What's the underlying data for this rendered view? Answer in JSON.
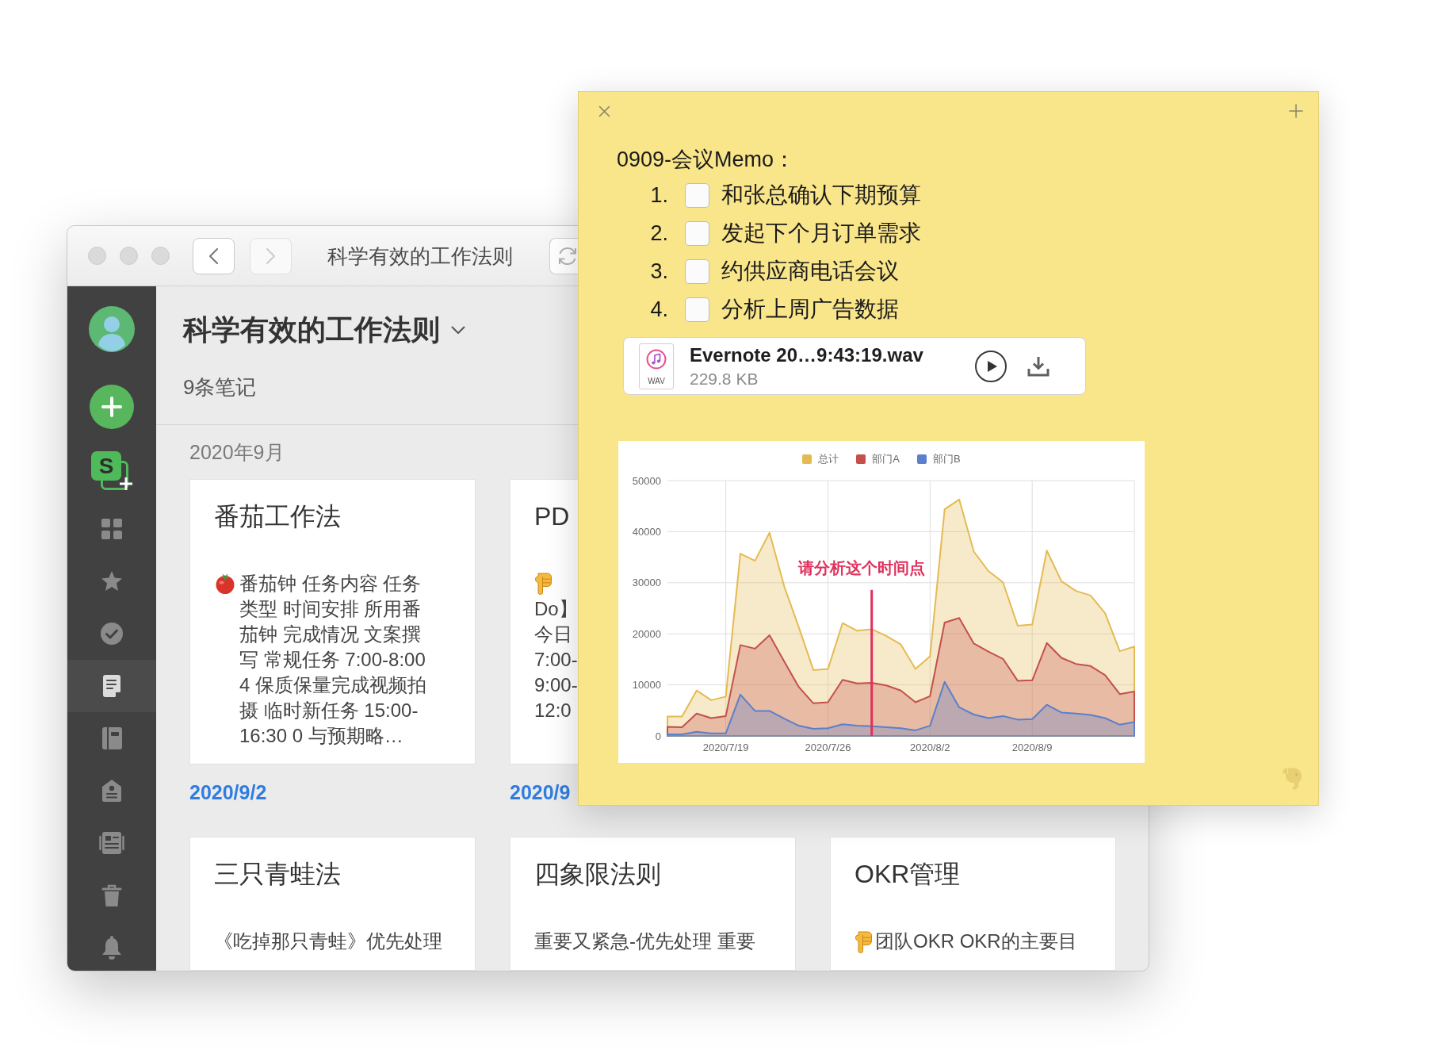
{
  "main_window": {
    "title": "科学有效的工作法则",
    "nav_buttons": [
      {
        "kind": "back",
        "disabled": false
      },
      {
        "kind": "forward",
        "disabled": true
      }
    ]
  },
  "sidebar": {
    "space_button": "S",
    "nav": [
      {
        "kind": "grid",
        "selected": false
      },
      {
        "kind": "star",
        "selected": false
      },
      {
        "kind": "check",
        "selected": false
      },
      {
        "kind": "note",
        "selected": true
      },
      {
        "kind": "notebook",
        "selected": false
      },
      {
        "kind": "tag",
        "selected": false
      },
      {
        "kind": "shared",
        "selected": false
      },
      {
        "kind": "trash",
        "selected": false
      },
      {
        "kind": "bell",
        "selected": false
      }
    ]
  },
  "notebook": {
    "title": "科学有效的工作法则",
    "note_count": "9条笔记",
    "month": "2020年9月",
    "rows": [
      {
        "notes": [
          {
            "kind": "tomato",
            "title": "番茄工作法",
            "preview": "番茄钟 任务内容 任务类型 时间安排 所用番茄钟 完成情况 文案撰写 常规任务 7:00-8:00 4 保质保量完成视频拍摄 临时新任务 15:00-16:30 0 与预期略…",
            "date": "2020/9/2"
          },
          {
            "kind": "pointing",
            "title": "PD",
            "preview": "Do】今日7:00-9:00-12:0",
            "date": "2020/9"
          }
        ]
      },
      {
        "notes": [
          {
            "kind": "plain",
            "title": "三只青蛙法",
            "preview": "《吃掉那只青蛙》优先处理"
          },
          {
            "kind": "plain",
            "title": "四象限法则",
            "preview": "重要又紧急-优先处理 重要"
          },
          {
            "kind": "pointing",
            "title": "OKR管理",
            "preview": "团队OKR OKR的主要目"
          }
        ]
      }
    ]
  },
  "sticky_note": {
    "title": "0909-会议Memo：",
    "tasks": [
      {
        "number": "1.",
        "text": "和张总确认下期预算",
        "checked": false
      },
      {
        "number": "2.",
        "text": "发起下个月订单需求",
        "checked": false
      },
      {
        "number": "3.",
        "text": "约供应商电话会议",
        "checked": false
      },
      {
        "number": "4.",
        "text": "分析上周广告数据",
        "checked": false
      }
    ],
    "attachment": {
      "file_type": "WAV",
      "name": "Evernote 20…9:43:19.wav",
      "size": "229.8 KB"
    },
    "chart": {
      "chart_data": {
        "type": "area",
        "stacked": false,
        "grid": true,
        "legend": "top",
        "categories": [
          null,
          null,
          null,
          null,
          "2020/7/19",
          null,
          null,
          null,
          null,
          null,
          null,
          "2020/7/26",
          null,
          null,
          null,
          null,
          null,
          null,
          "2020/8/2",
          null,
          null,
          null,
          null,
          null,
          null,
          "2020/8/9",
          null,
          null,
          null,
          null,
          null,
          null,
          null
        ],
        "ylim": [
          0,
          50000
        ],
        "yticks": [
          0,
          10000,
          20000,
          30000,
          40000,
          50000
        ],
        "series": [
          {
            "name": "总计",
            "color": "#e4bb52",
            "values": [
              3800,
              3800,
              8900,
              7000,
              7700,
              35700,
              34300,
              39800,
              29300,
              21300,
              12900,
              13100,
              22100,
              20600,
              20900,
              19600,
              17900,
              13100,
              15600,
              44400,
              46300,
              36100,
              32300,
              30100,
              21600,
              21800,
              36300,
              30300,
              28400,
              27500,
              24000,
              16600,
              17500
            ]
          },
          {
            "name": "部门A",
            "color": "#c4504b",
            "values": [
              1800,
              1700,
              4400,
              3500,
              3900,
              17800,
              17100,
              19700,
              14600,
              9600,
              6400,
              6600,
              11000,
              10300,
              10400,
              9900,
              8900,
              6600,
              7800,
              22200,
              23100,
              18100,
              16500,
              15100,
              10800,
              10900,
              18200,
              15300,
              14100,
              13700,
              11900,
              8200,
              8700
            ]
          },
          {
            "name": "部门B",
            "color": "#5b7fcc",
            "values": [
              300,
              300,
              800,
              500,
              500,
              8100,
              4900,
              4900,
              3400,
              2000,
              1400,
              1500,
              2300,
              2000,
              1900,
              1700,
              1500,
              1100,
              2000,
              10600,
              5600,
              4200,
              3500,
              3900,
              3200,
              3300,
              6100,
              4600,
              4400,
              4100,
              3500,
              2200,
              2700
            ]
          }
        ],
        "annotations": [
          "请分析这个时间点"
        ]
      }
    }
  }
}
